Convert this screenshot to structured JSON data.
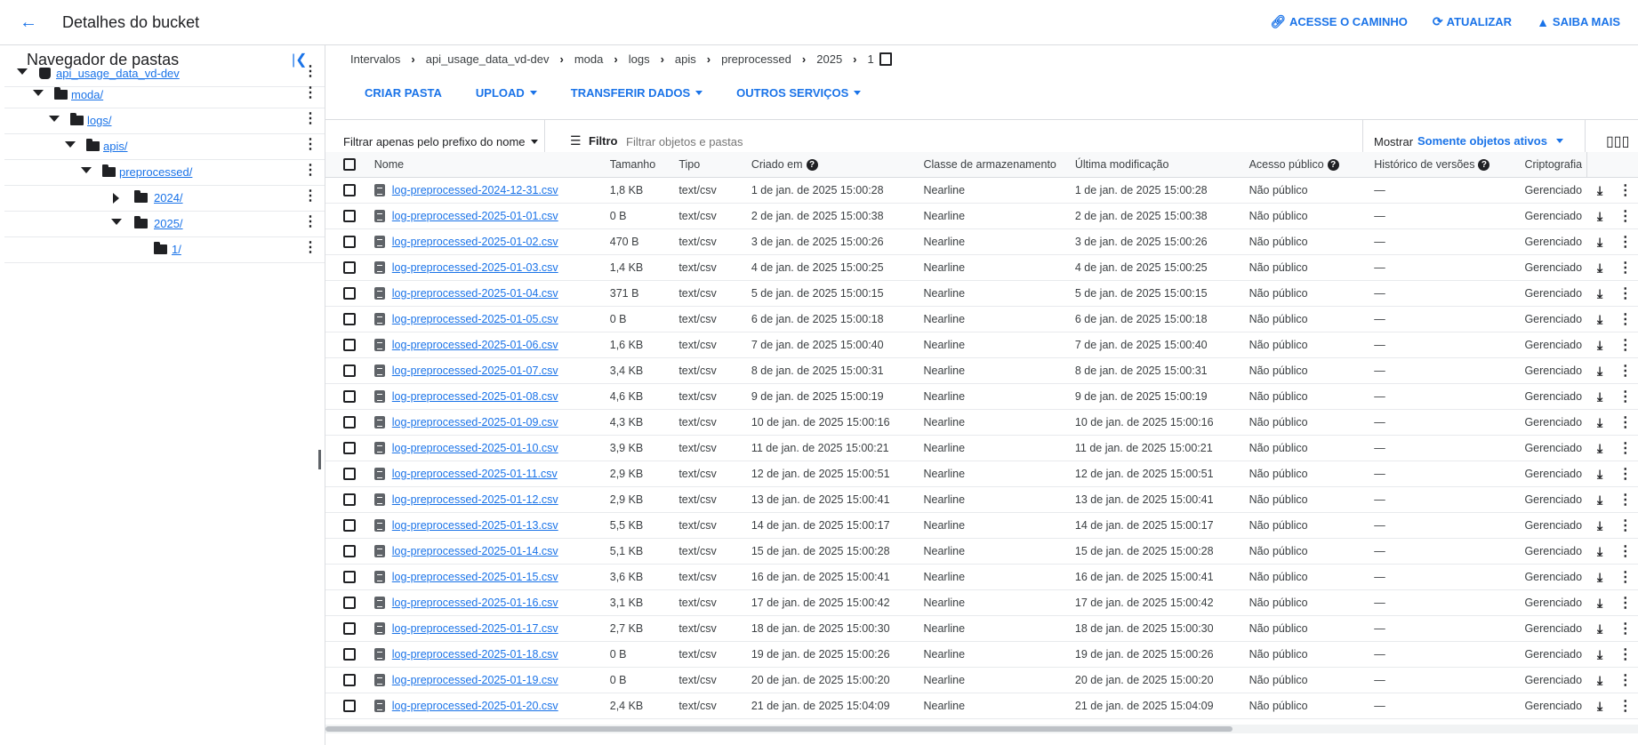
{
  "header": {
    "title": "Detalhes do bucket",
    "actions": [
      {
        "label": "ACESSE O CAMINHO",
        "icon": "link-icon"
      },
      {
        "label": "ATUALIZAR",
        "icon": "refresh-icon"
      },
      {
        "label": "SAIBA MAIS",
        "icon": "school-icon"
      }
    ]
  },
  "folder_nav": {
    "title": "Navegador de pastas",
    "tree": [
      {
        "label": "api_usage_data_vd-dev",
        "type": "bucket",
        "expanded": true
      },
      {
        "label": "moda/",
        "type": "folder",
        "expanded": true
      },
      {
        "label": "logs/",
        "type": "folder",
        "expanded": true
      },
      {
        "label": "apis/",
        "type": "folder",
        "expanded": true
      },
      {
        "label": "preprocessed/",
        "type": "folder",
        "expanded": true
      },
      {
        "label": "2024/",
        "type": "folder",
        "expanded": false
      },
      {
        "label": "2025/",
        "type": "folder",
        "expanded": true
      },
      {
        "label": "1/",
        "type": "folder",
        "expanded": false
      }
    ]
  },
  "breadcrumb": [
    "Intervalos",
    "api_usage_data_vd-dev",
    "moda",
    "logs",
    "apis",
    "preprocessed",
    "2025",
    "1"
  ],
  "toolbar": {
    "create_folder": "CRIAR PASTA",
    "upload": "UPLOAD",
    "transfer": "TRANSFERIR DADOS",
    "other": "OUTROS SERVIÇOS"
  },
  "filter": {
    "prefix_label": "Filtrar apenas pelo prefixo do nome",
    "filter_label": "Filtro",
    "placeholder": "Filtrar objetos e pastas",
    "show_label": "Mostrar",
    "show_value": "Somente objetos ativos"
  },
  "table": {
    "columns": [
      "Nome",
      "Tamanho",
      "Tipo",
      "Criado em",
      "Classe de armazenamento",
      "Última modificação",
      "Acesso público",
      "Histórico de versões",
      "Criptografia"
    ],
    "rows": [
      {
        "name": "log-preprocessed-2024-12-31.csv",
        "size": "1,8 KB",
        "type": "text/csv",
        "created": "1 de jan. de 2025 15:00:28",
        "class": "Nearline",
        "modified": "1 de jan. de 2025 15:00:28",
        "access": "Não público",
        "history": "—",
        "crypto": "Gerenciado"
      },
      {
        "name": "log-preprocessed-2025-01-01.csv",
        "size": "0 B",
        "type": "text/csv",
        "created": "2 de jan. de 2025 15:00:38",
        "class": "Nearline",
        "modified": "2 de jan. de 2025 15:00:38",
        "access": "Não público",
        "history": "—",
        "crypto": "Gerenciado"
      },
      {
        "name": "log-preprocessed-2025-01-02.csv",
        "size": "470 B",
        "type": "text/csv",
        "created": "3 de jan. de 2025 15:00:26",
        "class": "Nearline",
        "modified": "3 de jan. de 2025 15:00:26",
        "access": "Não público",
        "history": "—",
        "crypto": "Gerenciado"
      },
      {
        "name": "log-preprocessed-2025-01-03.csv",
        "size": "1,4 KB",
        "type": "text/csv",
        "created": "4 de jan. de 2025 15:00:25",
        "class": "Nearline",
        "modified": "4 de jan. de 2025 15:00:25",
        "access": "Não público",
        "history": "—",
        "crypto": "Gerenciado"
      },
      {
        "name": "log-preprocessed-2025-01-04.csv",
        "size": "371 B",
        "type": "text/csv",
        "created": "5 de jan. de 2025 15:00:15",
        "class": "Nearline",
        "modified": "5 de jan. de 2025 15:00:15",
        "access": "Não público",
        "history": "—",
        "crypto": "Gerenciado"
      },
      {
        "name": "log-preprocessed-2025-01-05.csv",
        "size": "0 B",
        "type": "text/csv",
        "created": "6 de jan. de 2025 15:00:18",
        "class": "Nearline",
        "modified": "6 de jan. de 2025 15:00:18",
        "access": "Não público",
        "history": "—",
        "crypto": "Gerenciado"
      },
      {
        "name": "log-preprocessed-2025-01-06.csv",
        "size": "1,6 KB",
        "type": "text/csv",
        "created": "7 de jan. de 2025 15:00:40",
        "class": "Nearline",
        "modified": "7 de jan. de 2025 15:00:40",
        "access": "Não público",
        "history": "—",
        "crypto": "Gerenciado"
      },
      {
        "name": "log-preprocessed-2025-01-07.csv",
        "size": "3,4 KB",
        "type": "text/csv",
        "created": "8 de jan. de 2025 15:00:31",
        "class": "Nearline",
        "modified": "8 de jan. de 2025 15:00:31",
        "access": "Não público",
        "history": "—",
        "crypto": "Gerenciado"
      },
      {
        "name": "log-preprocessed-2025-01-08.csv",
        "size": "4,6 KB",
        "type": "text/csv",
        "created": "9 de jan. de 2025 15:00:19",
        "class": "Nearline",
        "modified": "9 de jan. de 2025 15:00:19",
        "access": "Não público",
        "history": "—",
        "crypto": "Gerenciado"
      },
      {
        "name": "log-preprocessed-2025-01-09.csv",
        "size": "4,3 KB",
        "type": "text/csv",
        "created": "10 de jan. de 2025 15:00:16",
        "class": "Nearline",
        "modified": "10 de jan. de 2025 15:00:16",
        "access": "Não público",
        "history": "—",
        "crypto": "Gerenciado"
      },
      {
        "name": "log-preprocessed-2025-01-10.csv",
        "size": "3,9 KB",
        "type": "text/csv",
        "created": "11 de jan. de 2025 15:00:21",
        "class": "Nearline",
        "modified": "11 de jan. de 2025 15:00:21",
        "access": "Não público",
        "history": "—",
        "crypto": "Gerenciado"
      },
      {
        "name": "log-preprocessed-2025-01-11.csv",
        "size": "2,9 KB",
        "type": "text/csv",
        "created": "12 de jan. de 2025 15:00:51",
        "class": "Nearline",
        "modified": "12 de jan. de 2025 15:00:51",
        "access": "Não público",
        "history": "—",
        "crypto": "Gerenciado"
      },
      {
        "name": "log-preprocessed-2025-01-12.csv",
        "size": "2,9 KB",
        "type": "text/csv",
        "created": "13 de jan. de 2025 15:00:41",
        "class": "Nearline",
        "modified": "13 de jan. de 2025 15:00:41",
        "access": "Não público",
        "history": "—",
        "crypto": "Gerenciado"
      },
      {
        "name": "log-preprocessed-2025-01-13.csv",
        "size": "5,5 KB",
        "type": "text/csv",
        "created": "14 de jan. de 2025 15:00:17",
        "class": "Nearline",
        "modified": "14 de jan. de 2025 15:00:17",
        "access": "Não público",
        "history": "—",
        "crypto": "Gerenciado"
      },
      {
        "name": "log-preprocessed-2025-01-14.csv",
        "size": "5,1 KB",
        "type": "text/csv",
        "created": "15 de jan. de 2025 15:00:28",
        "class": "Nearline",
        "modified": "15 de jan. de 2025 15:00:28",
        "access": "Não público",
        "history": "—",
        "crypto": "Gerenciado"
      },
      {
        "name": "log-preprocessed-2025-01-15.csv",
        "size": "3,6 KB",
        "type": "text/csv",
        "created": "16 de jan. de 2025 15:00:41",
        "class": "Nearline",
        "modified": "16 de jan. de 2025 15:00:41",
        "access": "Não público",
        "history": "—",
        "crypto": "Gerenciado"
      },
      {
        "name": "log-preprocessed-2025-01-16.csv",
        "size": "3,1 KB",
        "type": "text/csv",
        "created": "17 de jan. de 2025 15:00:42",
        "class": "Nearline",
        "modified": "17 de jan. de 2025 15:00:42",
        "access": "Não público",
        "history": "—",
        "crypto": "Gerenciado"
      },
      {
        "name": "log-preprocessed-2025-01-17.csv",
        "size": "2,7 KB",
        "type": "text/csv",
        "created": "18 de jan. de 2025 15:00:30",
        "class": "Nearline",
        "modified": "18 de jan. de 2025 15:00:30",
        "access": "Não público",
        "history": "—",
        "crypto": "Gerenciado"
      },
      {
        "name": "log-preprocessed-2025-01-18.csv",
        "size": "0 B",
        "type": "text/csv",
        "created": "19 de jan. de 2025 15:00:26",
        "class": "Nearline",
        "modified": "19 de jan. de 2025 15:00:26",
        "access": "Não público",
        "history": "—",
        "crypto": "Gerenciado"
      },
      {
        "name": "log-preprocessed-2025-01-19.csv",
        "size": "0 B",
        "type": "text/csv",
        "created": "20 de jan. de 2025 15:00:20",
        "class": "Nearline",
        "modified": "20 de jan. de 2025 15:00:20",
        "access": "Não público",
        "history": "—",
        "crypto": "Gerenciado"
      },
      {
        "name": "log-preprocessed-2025-01-20.csv",
        "size": "2,4 KB",
        "type": "text/csv",
        "created": "21 de jan. de 2025 15:04:09",
        "class": "Nearline",
        "modified": "21 de jan. de 2025 15:04:09",
        "access": "Não público",
        "history": "—",
        "crypto": "Gerenciado"
      }
    ]
  },
  "colors": {
    "accent": "#1a73e8",
    "text": "#202124",
    "border": "#dadce0"
  }
}
